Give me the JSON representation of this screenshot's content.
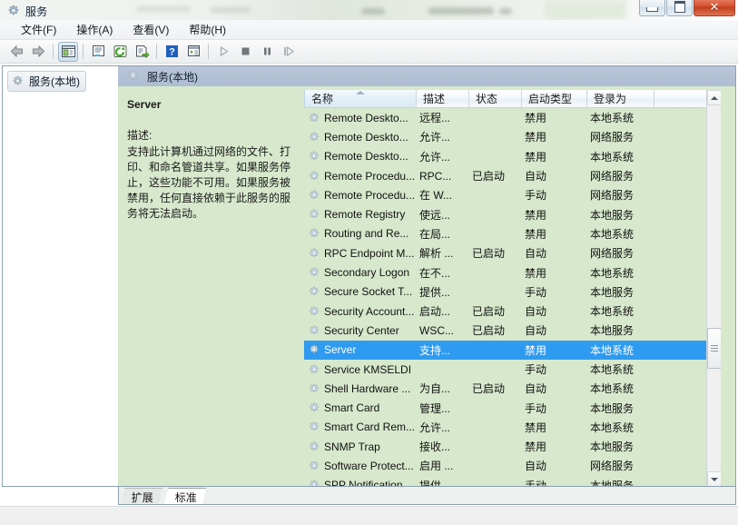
{
  "window": {
    "title": "服务",
    "icon": "gear-icon",
    "controls": {
      "minimize": "最小化",
      "maximize": "最大化",
      "close": "✕"
    }
  },
  "menubar": {
    "items": [
      {
        "label": "文件(F)",
        "name": "menu-file"
      },
      {
        "label": "操作(A)",
        "name": "menu-action"
      },
      {
        "label": "查看(V)",
        "name": "menu-view"
      },
      {
        "label": "帮助(H)",
        "name": "menu-help"
      }
    ]
  },
  "toolbar": {
    "buttons": [
      {
        "icon": "back-arrow-icon",
        "name": "toolbar-back",
        "enabled": true
      },
      {
        "icon": "forward-arrow-icon",
        "name": "toolbar-forward",
        "enabled": true
      },
      {
        "icon": "show-hide-tree-icon",
        "name": "toolbar-show-console-tree",
        "enabled": true,
        "pressed": true
      },
      {
        "icon": "properties-icon",
        "name": "toolbar-properties",
        "enabled": true
      },
      {
        "icon": "refresh-icon",
        "name": "toolbar-refresh",
        "enabled": true
      },
      {
        "icon": "export-list-icon",
        "name": "toolbar-export-list",
        "enabled": true
      },
      {
        "icon": "help-icon",
        "name": "toolbar-help",
        "enabled": true
      },
      {
        "icon": "start-service-window-icon",
        "name": "toolbar-service-window",
        "enabled": true
      },
      {
        "icon": "play-icon",
        "name": "toolbar-start-service",
        "enabled": false
      },
      {
        "icon": "stop-icon",
        "name": "toolbar-stop-service",
        "enabled": false
      },
      {
        "icon": "pause-icon",
        "name": "toolbar-pause-service",
        "enabled": false
      },
      {
        "icon": "restart-icon",
        "name": "toolbar-restart-service",
        "enabled": false
      }
    ]
  },
  "tree": {
    "root": {
      "label": "服务(本地)",
      "icon": "gear-icon",
      "selected": true
    }
  },
  "pane_header": {
    "label": "服务(本地)",
    "icon": "gear-icon"
  },
  "details": {
    "service_name": "Server",
    "description_label": "描述:",
    "description_text": "支持此计算机通过网络的文件、打印、和命名管道共享。如果服务停止，这些功能不可用。如果服务被禁用，任何直接依赖于此服务的服务将无法启动。"
  },
  "list": {
    "columns": [
      {
        "label": "名称",
        "name": "column-name",
        "width": 124,
        "sorted": true,
        "sort_dir": "asc"
      },
      {
        "label": "描述",
        "name": "column-description",
        "width": 58
      },
      {
        "label": "状态",
        "name": "column-status",
        "width": 58
      },
      {
        "label": "启动类型",
        "name": "column-startup-type",
        "width": 72
      },
      {
        "label": "登录为",
        "name": "column-log-on-as",
        "width": 74
      },
      {
        "label": "",
        "name": "column-filler",
        "width": 58
      }
    ],
    "rows": [
      {
        "name": "Remote Deskto...",
        "description": "远程...",
        "status": "",
        "startup": "禁用",
        "logon": "本地系统",
        "selected": false
      },
      {
        "name": "Remote Deskto...",
        "description": "允许...",
        "status": "",
        "startup": "禁用",
        "logon": "网络服务",
        "selected": false
      },
      {
        "name": "Remote Deskto...",
        "description": "允许...",
        "status": "",
        "startup": "禁用",
        "logon": "本地系统",
        "selected": false
      },
      {
        "name": "Remote Procedu...",
        "description": "RPC...",
        "status": "已启动",
        "startup": "自动",
        "logon": "网络服务",
        "selected": false
      },
      {
        "name": "Remote Procedu...",
        "description": "在 W...",
        "status": "",
        "startup": "手动",
        "logon": "网络服务",
        "selected": false
      },
      {
        "name": "Remote Registry",
        "description": "使远...",
        "status": "",
        "startup": "禁用",
        "logon": "本地服务",
        "selected": false
      },
      {
        "name": "Routing and Re...",
        "description": "在局...",
        "status": "",
        "startup": "禁用",
        "logon": "本地系统",
        "selected": false
      },
      {
        "name": "RPC Endpoint M...",
        "description": "解析 ...",
        "status": "已启动",
        "startup": "自动",
        "logon": "网络服务",
        "selected": false
      },
      {
        "name": "Secondary Logon",
        "description": "在不...",
        "status": "",
        "startup": "禁用",
        "logon": "本地系统",
        "selected": false
      },
      {
        "name": "Secure Socket T...",
        "description": "提供...",
        "status": "",
        "startup": "手动",
        "logon": "本地服务",
        "selected": false
      },
      {
        "name": "Security Account...",
        "description": "启动...",
        "status": "已启动",
        "startup": "自动",
        "logon": "本地系统",
        "selected": false
      },
      {
        "name": "Security Center",
        "description": "WSC...",
        "status": "已启动",
        "startup": "自动",
        "logon": "本地服务",
        "selected": false
      },
      {
        "name": "Server",
        "description": "支持...",
        "status": "",
        "startup": "禁用",
        "logon": "本地系统",
        "selected": true
      },
      {
        "name": "Service KMSELDI",
        "description": "",
        "status": "",
        "startup": "手动",
        "logon": "本地系统",
        "selected": false
      },
      {
        "name": "Shell Hardware ...",
        "description": "为自...",
        "status": "已启动",
        "startup": "自动",
        "logon": "本地系统",
        "selected": false
      },
      {
        "name": "Smart Card",
        "description": "管理...",
        "status": "",
        "startup": "手动",
        "logon": "本地服务",
        "selected": false
      },
      {
        "name": "Smart Card Rem...",
        "description": "允许...",
        "status": "",
        "startup": "禁用",
        "logon": "本地系统",
        "selected": false
      },
      {
        "name": "SNMP Trap",
        "description": "接收...",
        "status": "",
        "startup": "禁用",
        "logon": "本地服务",
        "selected": false
      },
      {
        "name": "Software Protect...",
        "description": "启用 ...",
        "status": "",
        "startup": "自动",
        "logon": "网络服务",
        "selected": false
      },
      {
        "name": "SPP Notification",
        "description": "提供...",
        "status": "",
        "startup": "手动",
        "logon": "本地服务",
        "selected": false
      }
    ]
  },
  "tabs": [
    {
      "label": "扩展",
      "name": "tab-extended",
      "active": false
    },
    {
      "label": "标准",
      "name": "tab-standard",
      "active": true
    }
  ],
  "colors": {
    "selection": "#2e9bf0",
    "list_background": "#d7e8cc",
    "header_band": "#aebdd2"
  }
}
